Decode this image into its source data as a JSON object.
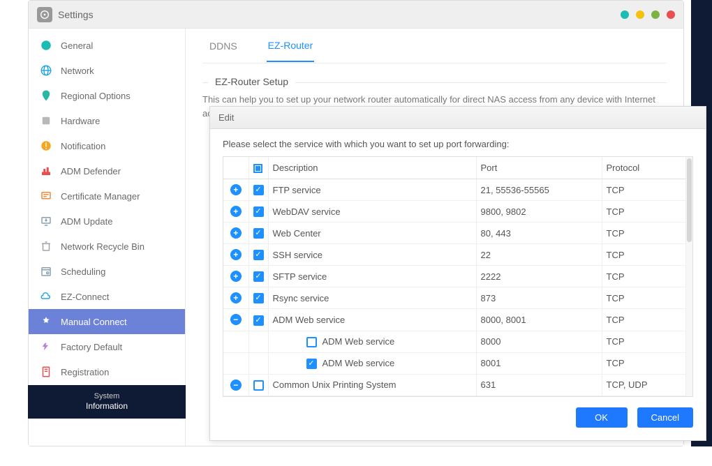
{
  "window": {
    "title": "Settings"
  },
  "traffic_colors": [
    "#1cbbb4",
    "#f4c20d",
    "#7cb342",
    "#e94f4f"
  ],
  "sidebar": {
    "items": [
      {
        "label": "General",
        "icon": "general",
        "color": "#1cbbb4"
      },
      {
        "label": "Network",
        "icon": "network",
        "color": "#2aa7e0"
      },
      {
        "label": "Regional Options",
        "icon": "regional",
        "color": "#29b6a5"
      },
      {
        "label": "Hardware",
        "icon": "hardware",
        "color": "#b8b8b8"
      },
      {
        "label": "Notification",
        "icon": "notification",
        "color": "#f6a623"
      },
      {
        "label": "ADM Defender",
        "icon": "defender",
        "color": "#e94f4f"
      },
      {
        "label": "Certificate Manager",
        "icon": "cert",
        "color": "#f08a3c"
      },
      {
        "label": "ADM Update",
        "icon": "update",
        "color": "#8aa0b2"
      },
      {
        "label": "Network Recycle Bin",
        "icon": "recycle",
        "color": "#9aa5ae"
      },
      {
        "label": "Scheduling",
        "icon": "scheduling",
        "color": "#8aa0b2"
      },
      {
        "label": "EZ-Connect",
        "icon": "ezconnect",
        "color": "#2aa7e0"
      },
      {
        "label": "Manual Connect",
        "icon": "manual",
        "color": "#ffffff",
        "active": true
      },
      {
        "label": "Factory Default",
        "icon": "factory",
        "color": "#b57edc"
      },
      {
        "label": "Registration",
        "icon": "registration",
        "color": "#e94f4f"
      }
    ]
  },
  "dark_strip": {
    "line1": "System",
    "line2": "Information"
  },
  "tabs": [
    {
      "label": "DDNS",
      "active": false
    },
    {
      "label": "EZ-Router",
      "active": true
    }
  ],
  "fieldset": {
    "legend": "EZ-Router Setup",
    "desc": "This can help you to set up your network router automatically for direct NAS access from any device with Internet access. (e.g., laptop and mobile phone)"
  },
  "dialog": {
    "title": "Edit",
    "instruction": "Please select the service with which you want to set up port forwarding:",
    "headers": {
      "description": "Description",
      "port": "Port",
      "protocol": "Protocol"
    },
    "rows": [
      {
        "expand": "plus",
        "checked": true,
        "desc": "FTP service",
        "port": "21, 55536-55565",
        "proto": "TCP"
      },
      {
        "expand": "plus",
        "checked": true,
        "desc": "WebDAV service",
        "port": "9800, 9802",
        "proto": "TCP"
      },
      {
        "expand": "plus",
        "checked": true,
        "desc": "Web Center",
        "port": "80, 443",
        "proto": "TCP"
      },
      {
        "expand": "plus",
        "checked": true,
        "desc": "SSH service",
        "port": "22",
        "proto": "TCP"
      },
      {
        "expand": "plus",
        "checked": true,
        "desc": "SFTP service",
        "port": "2222",
        "proto": "TCP"
      },
      {
        "expand": "plus",
        "checked": true,
        "desc": "Rsync service",
        "port": "873",
        "proto": "TCP"
      },
      {
        "expand": "minus",
        "checked": true,
        "desc": "ADM Web service",
        "port": "8000, 8001",
        "proto": "TCP"
      },
      {
        "child": true,
        "checked": false,
        "desc": "ADM Web service",
        "port": "8000",
        "proto": "TCP"
      },
      {
        "child": true,
        "checked": true,
        "desc": "ADM Web service",
        "port": "8001",
        "proto": "TCP"
      },
      {
        "expand": "minus",
        "checked": false,
        "desc": "Common Unix Printing System",
        "port": "631",
        "proto": "TCP, UDP"
      }
    ],
    "buttons": {
      "ok": "OK",
      "cancel": "Cancel"
    }
  }
}
